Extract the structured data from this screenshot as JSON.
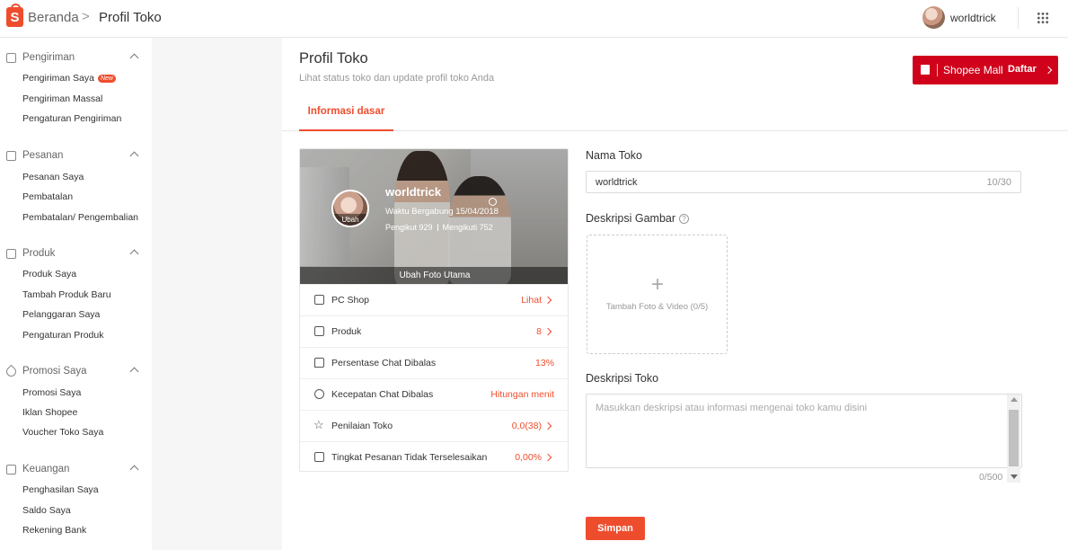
{
  "header": {
    "home": "Beranda",
    "separator": ">",
    "current": "Profil Toko",
    "username": "worldtrick"
  },
  "sidebar": {
    "sections": [
      {
        "title": "Pengiriman",
        "items": [
          "Pengiriman Saya",
          "Pengiriman Massal",
          "Pengaturan Pengiriman"
        ],
        "badge": "New"
      },
      {
        "title": "Pesanan",
        "items": [
          "Pesanan Saya",
          "Pembatalan",
          "Pembatalan/ Pengembalian"
        ]
      },
      {
        "title": "Produk",
        "items": [
          "Produk Saya",
          "Tambah Produk Baru",
          "Pelanggaran Saya",
          "Pengaturan Produk"
        ]
      },
      {
        "title": "Promosi Saya",
        "items": [
          "Promosi Saya",
          "Iklan Shopee",
          "Voucher Toko Saya"
        ]
      },
      {
        "title": "Keuangan",
        "items": [
          "Penghasilan Saya",
          "Saldo Saya",
          "Rekening Bank"
        ]
      }
    ]
  },
  "page": {
    "title": "Profil Toko",
    "subtitle": "Lihat status toko dan update profil toko Anda",
    "tab": "Informasi dasar",
    "mall": {
      "label": "Shopee Mall",
      "action": "Daftar"
    }
  },
  "card": {
    "shop_name": "worldtrick",
    "avatar_label": "Ubah",
    "joined": "Waktu Bergabung 15/04/2018",
    "followers": "Pengikut 929",
    "following": "Mengikuti 752",
    "change_photo": "Ubah Foto Utama",
    "rows": [
      {
        "label": "PC Shop",
        "value": "Lihat"
      },
      {
        "label": "Produk",
        "value": "8"
      },
      {
        "label": "Persentase Chat Dibalas",
        "value": "13%"
      },
      {
        "label": "Kecepatan Chat Dibalas",
        "value": "Hitungan menit"
      },
      {
        "label": "Penilaian Toko",
        "value": "0,0(38)"
      },
      {
        "label": "Tingkat Pesanan Tidak Terselesaikan",
        "value": "0,00%"
      }
    ]
  },
  "form": {
    "name_label": "Nama Toko",
    "name_value": "worldtrick",
    "name_count": "10/30",
    "image_label": "Deskripsi Gambar",
    "upload_text": "Tambah Foto & Video (0/5)",
    "desc_label": "Deskripsi Toko",
    "desc_placeholder": "Masukkan deskripsi atau informasi mengenai toko kamu disini",
    "desc_count": "0/500",
    "save": "Simpan"
  },
  "colors": {
    "primary": "#ee4d2d",
    "mall": "#d0011b"
  }
}
